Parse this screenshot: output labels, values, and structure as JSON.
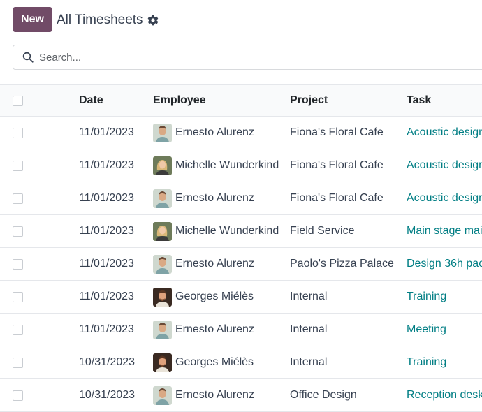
{
  "toolbar": {
    "new_label": "New",
    "title": "All Timesheets"
  },
  "search": {
    "placeholder": "Search..."
  },
  "table": {
    "columns": [
      "Date",
      "Employee",
      "Project",
      "Task"
    ],
    "rows": [
      {
        "date": "11/01/2023",
        "employee": "Ernesto Alurenz",
        "avatar": "ernesto",
        "project": "Fiona's Floral Cafe",
        "task": "Acoustic design"
      },
      {
        "date": "11/01/2023",
        "employee": "Michelle Wunderkind",
        "avatar": "michelle",
        "project": "Fiona's Floral Cafe",
        "task": "Acoustic design"
      },
      {
        "date": "11/01/2023",
        "employee": "Ernesto Alurenz",
        "avatar": "ernesto",
        "project": "Fiona's Floral Cafe",
        "task": "Acoustic design"
      },
      {
        "date": "11/01/2023",
        "employee": "Michelle Wunderkind",
        "avatar": "michelle",
        "project": "Field Service",
        "task": "Main stage mai"
      },
      {
        "date": "11/01/2023",
        "employee": "Ernesto Alurenz",
        "avatar": "ernesto",
        "project": "Paolo's Pizza Palace",
        "task": "Design 36h pac"
      },
      {
        "date": "11/01/2023",
        "employee": "Georges Miélès",
        "avatar": "georges",
        "project": "Internal",
        "task": "Training"
      },
      {
        "date": "11/01/2023",
        "employee": "Ernesto Alurenz",
        "avatar": "ernesto",
        "project": "Internal",
        "task": "Meeting"
      },
      {
        "date": "10/31/2023",
        "employee": "Georges Miélès",
        "avatar": "georges",
        "project": "Internal",
        "task": "Training"
      },
      {
        "date": "10/31/2023",
        "employee": "Ernesto Alurenz",
        "avatar": "ernesto",
        "project": "Office Design",
        "task": "Reception desk"
      }
    ]
  },
  "colors": {
    "primary": "#714b67",
    "task_link": "#017e84"
  },
  "icons": {
    "settings": "gear-icon",
    "search": "search-icon"
  }
}
